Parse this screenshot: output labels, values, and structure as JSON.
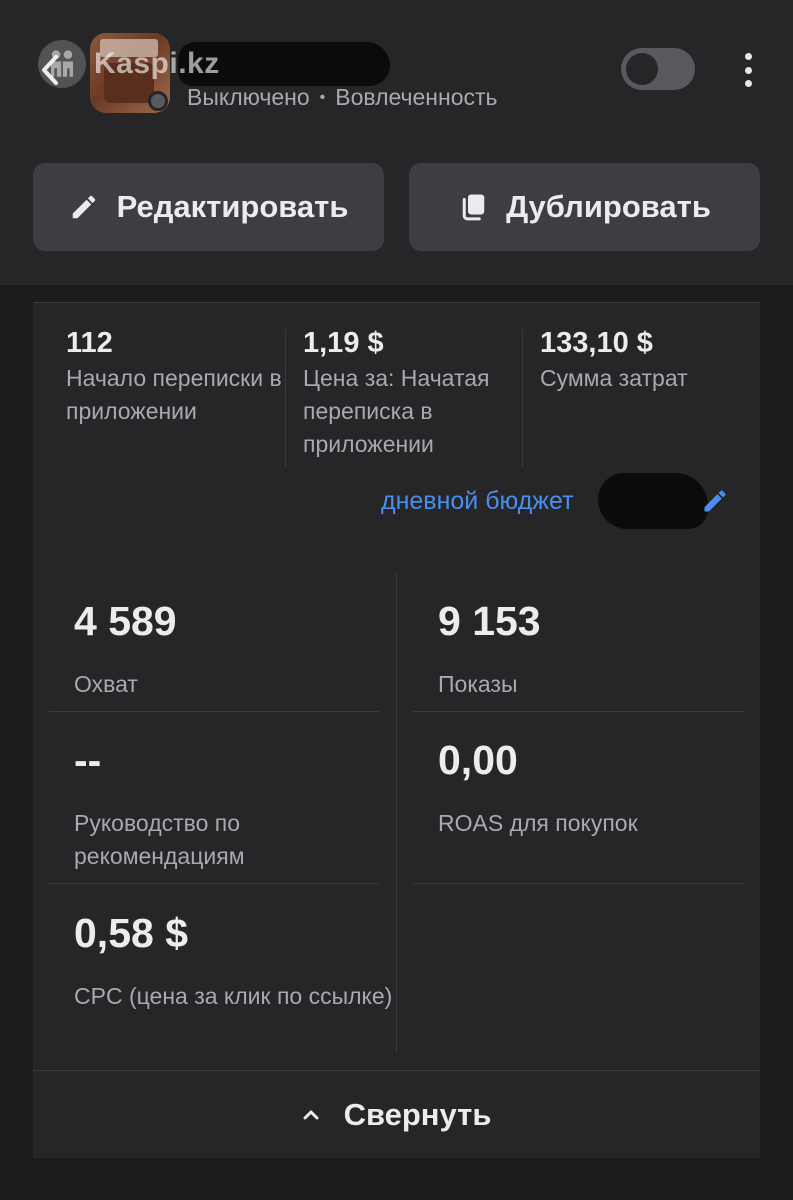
{
  "watermark": {
    "text": "Kaspi.kz"
  },
  "header": {
    "status": "Выключено",
    "separator": "•",
    "objective": "Вовлеченность"
  },
  "actions": {
    "edit_label": "Редактировать",
    "duplicate_label": "Дублировать"
  },
  "top_metrics": [
    {
      "value": "112",
      "label": "Начало переписки в приложении"
    },
    {
      "value": "1,19 $",
      "label": "Цена за: Начатая переписка в приложении"
    },
    {
      "value": "133,10 $",
      "label": "Сумма затрат"
    }
  ],
  "budget": {
    "label": "дневной бюджет"
  },
  "metrics": {
    "reach": {
      "value": "4 589",
      "label": "Охват"
    },
    "impressions": {
      "value": "9 153",
      "label": "Показы"
    },
    "recommendations": {
      "value": "--",
      "label": "Руководство по рекомендациям"
    },
    "roas": {
      "value": "0,00",
      "label": "ROAS для покупок"
    },
    "cpc": {
      "value": "0,58 $",
      "label": "CPC (цена за клик по ссылке)"
    }
  },
  "collapse": {
    "label": "Свернуть"
  },
  "colors": {
    "background": "#1c1c1e",
    "panel": "#262628",
    "button": "#3e3e42",
    "accent_link": "#4a8df0",
    "text_primary": "#ececee",
    "text_secondary": "#a9a9ae"
  },
  "icons": {
    "back": "chevron-left-icon",
    "toggle": "toggle-switch-off",
    "more": "more-vertical-icon",
    "edit": "pencil-icon",
    "duplicate": "copy-icon",
    "budget_edit": "pencil-icon",
    "collapse": "chevron-up-icon"
  }
}
